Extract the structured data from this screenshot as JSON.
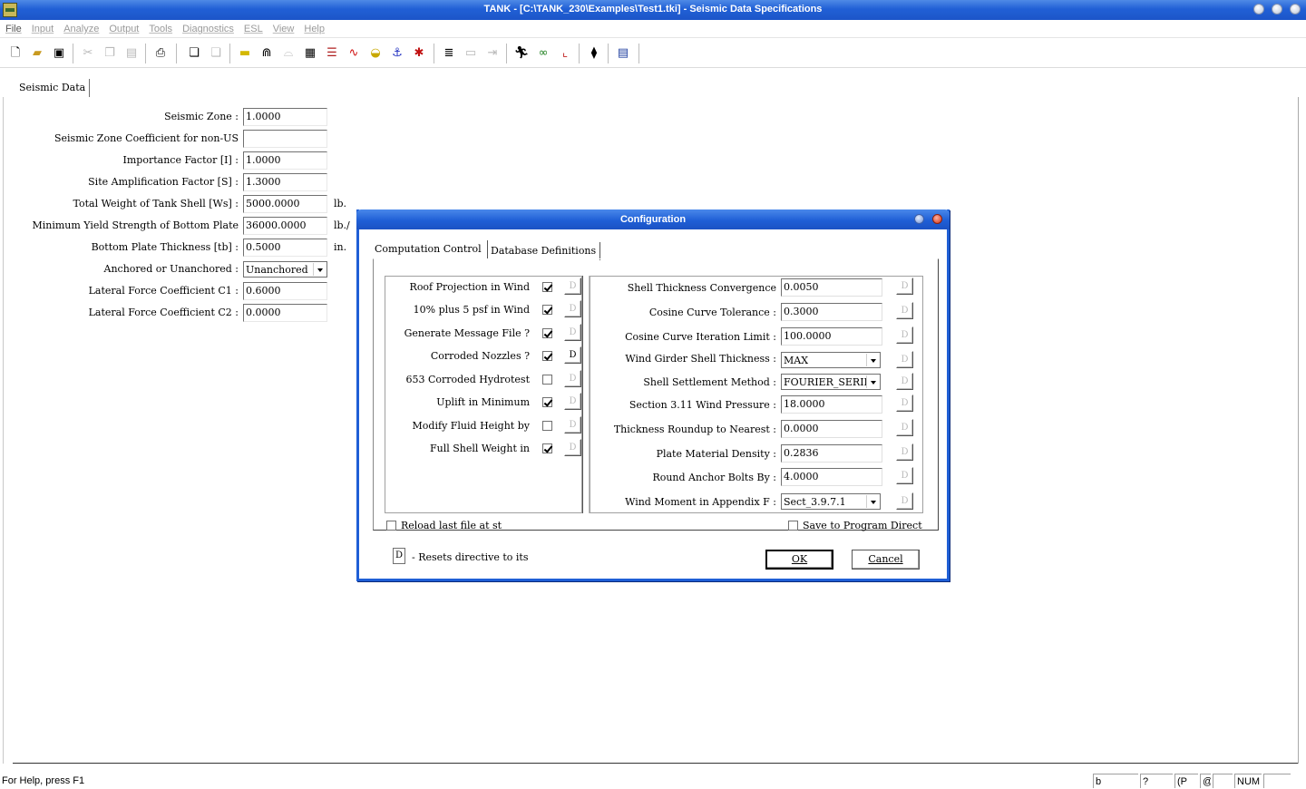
{
  "window": {
    "title": "TANK - [C:\\TANK_230\\Examples\\Test1.tki] - Seismic Data Specifications"
  },
  "menu": [
    "File",
    "Input",
    "Analyze",
    "Output",
    "Tools",
    "Diagnostics",
    "ESL",
    "View",
    "Help"
  ],
  "toolbar": {
    "icons": [
      "new-file-icon",
      "open-folder-icon",
      "save-icon",
      "cut-icon",
      "copy-icon",
      "paste-icon",
      "print-icon",
      "copy-doc-icon",
      "paste-doc-icon",
      "plate-icon",
      "roof-icon",
      "bottom-icon",
      "grid-icon",
      "ladder-icon",
      "wave-icon",
      "nozzle-icon",
      "anchor-icon",
      "wind-icon",
      "report-icon",
      "table-icon",
      "export-icon",
      "run-icon",
      "glasses-icon",
      "chart-icon",
      "config-icon",
      "esl-icon"
    ]
  },
  "main": {
    "tab": "Seismic Data",
    "fields": [
      {
        "label": "Seismic Zone :",
        "value": "1.0000",
        "unit": ""
      },
      {
        "label": "Seismic Zone Coefficient for non-US",
        "value": "",
        "unit": ""
      },
      {
        "label": "Importance Factor [I] :",
        "value": "1.0000",
        "unit": ""
      },
      {
        "label": "Site Amplification Factor [S] :",
        "value": "1.3000",
        "unit": ""
      },
      {
        "label": "Total Weight of Tank Shell [Ws] :",
        "value": "5000.0000",
        "unit": "lb."
      },
      {
        "label": "Minimum Yield Strength of Bottom Plate",
        "value": "36000.0000",
        "unit": "lb./"
      },
      {
        "label": "Bottom Plate Thickness [tb] :",
        "value": "0.5000",
        "unit": "in."
      },
      {
        "label": "Anchored or Unanchored :",
        "value": "Unanchored",
        "unit": ""
      },
      {
        "label": "Lateral Force Coefficient C1 :",
        "value": "0.6000",
        "unit": ""
      },
      {
        "label": "Lateral Force Coefficient C2 :",
        "value": "0.0000",
        "unit": ""
      }
    ]
  },
  "dialog": {
    "title": "Configuration",
    "tabs": [
      "Computation Control",
      "Database Definitions"
    ],
    "left_options": [
      {
        "label": "Roof Projection in Wind",
        "checked": true,
        "reset": "D",
        "reset_enabled": false
      },
      {
        "label": "10% plus 5 psf in Wind",
        "checked": true,
        "reset": "D",
        "reset_enabled": false
      },
      {
        "label": "Generate Message File ?",
        "checked": true,
        "reset": "D",
        "reset_enabled": false
      },
      {
        "label": "Corroded Nozzles ?",
        "checked": true,
        "reset": "D",
        "reset_enabled": true
      },
      {
        "label": "653 Corroded Hydrotest",
        "checked": false,
        "reset": "D",
        "reset_enabled": false
      },
      {
        "label": "Uplift in Minimum",
        "checked": true,
        "reset": "D",
        "reset_enabled": false
      },
      {
        "label": "Modify Fluid Height by",
        "checked": false,
        "reset": "D",
        "reset_enabled": false
      },
      {
        "label": "Full Shell Weight in",
        "checked": true,
        "reset": "D",
        "reset_enabled": false
      }
    ],
    "right_options": [
      {
        "label": "Shell Thickness Convergence",
        "value": "0.0050",
        "type": "input",
        "reset": "D"
      },
      {
        "label": "Cosine Curve Tolerance :",
        "value": "0.3000",
        "type": "input",
        "reset": "D"
      },
      {
        "label": "Cosine Curve Iteration Limit :",
        "value": "100.0000",
        "type": "input",
        "reset": "D"
      },
      {
        "label": "Wind Girder Shell Thickness :",
        "value": "MAX",
        "type": "select",
        "reset": "D"
      },
      {
        "label": "Shell Settlement Method :",
        "value": "FOURIER_SERIES",
        "type": "select",
        "reset": "D"
      },
      {
        "label": "Section 3.11 Wind Pressure :",
        "value": "18.0000",
        "type": "input",
        "reset": "D"
      },
      {
        "label": "Thickness Roundup to Nearest :",
        "value": "0.0000",
        "type": "input",
        "reset": "D"
      },
      {
        "label": "Plate Material Density :",
        "value": "0.2836",
        "type": "input",
        "reset": "D"
      },
      {
        "label": "Round Anchor Bolts By :",
        "value": "4.0000",
        "type": "input",
        "reset": "D"
      },
      {
        "label": "Wind Moment in Appendix F :",
        "value": "Sect_3.9.7.1",
        "type": "select",
        "reset": "D"
      }
    ],
    "reload_label": "Reload last file at st",
    "save_label": "Save to Program Direct",
    "legend_key": "D",
    "legend_text": "- Resets directive to its",
    "ok_label": "OK",
    "cancel_label": "Cancel"
  },
  "status": {
    "help": "For Help, press F1",
    "panes": [
      "b",
      "?",
      "(P",
      "@",
      "",
      "NUM",
      ""
    ]
  }
}
